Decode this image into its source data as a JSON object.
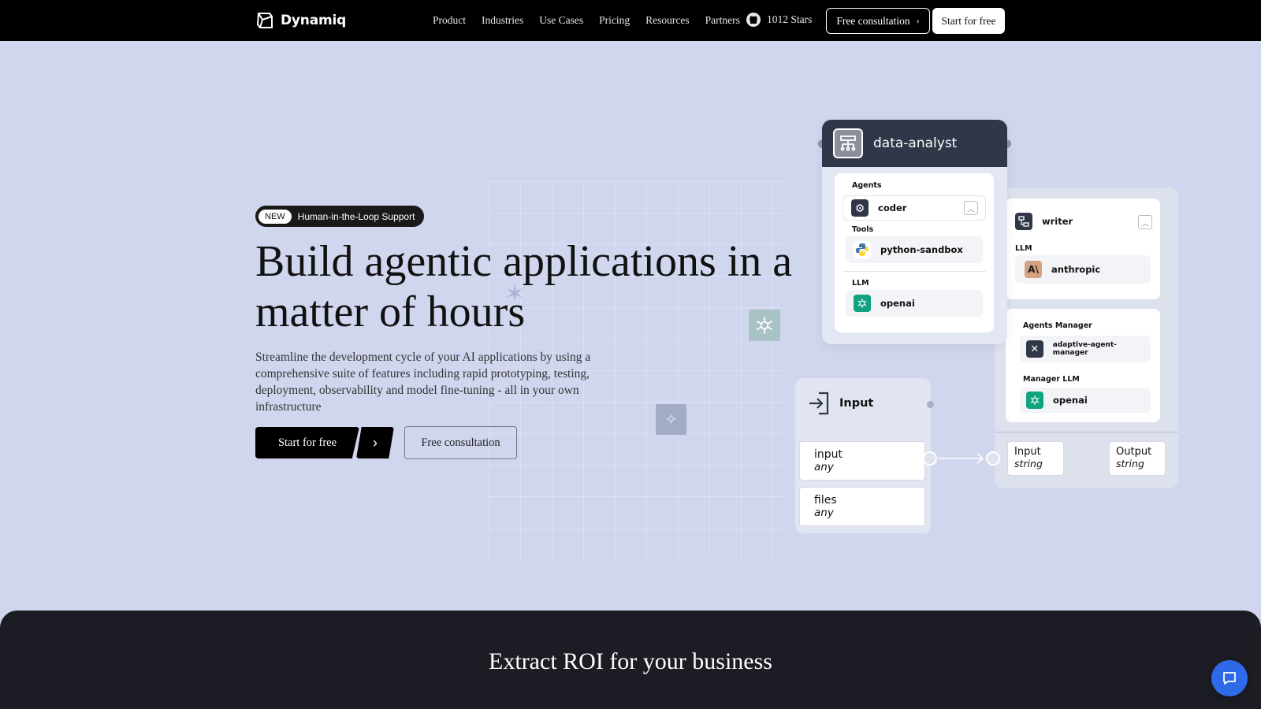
{
  "nav": {
    "logo": "Dynamiq",
    "links": [
      "Product",
      "Industries",
      "Use Cases",
      "Pricing",
      "Resources",
      "Partners"
    ],
    "stars": "1012 Stars",
    "consult_label": "Free consultation",
    "start_label": "Start for free"
  },
  "hero": {
    "badge_new": "NEW",
    "badge_text": "Human-in-the-Loop Support",
    "title": "Build agentic applications in a matter of hours",
    "subtitle": "Streamline the development cycle of your AI applications by using a comprehensive suite of features including rapid prototyping, testing, deployment, observability and model fine-tuning - all in your own infrastructure",
    "start_label": "Start for free",
    "consult_label": "Free consultation"
  },
  "data_analyst": {
    "title": "data-analyst",
    "agents_label": "Agents",
    "agent": "coder",
    "tools_label": "Tools",
    "tool": "python-sandbox",
    "llm_label": "LLM",
    "llm": "openai"
  },
  "writer": {
    "title": "writer",
    "llm_label": "LLM",
    "llm": "anthropic",
    "manager_label": "Agents Manager",
    "manager": "adaptive-agent-manager",
    "manager_llm_label": "Manager LLM",
    "manager_llm": "openai",
    "input_name": "Input",
    "input_type": "string",
    "output_name": "Output",
    "output_type": "string"
  },
  "input_node": {
    "title": "Input",
    "fields": [
      {
        "name": "input",
        "type": "any"
      },
      {
        "name": "files",
        "type": "any"
      }
    ]
  },
  "section": {
    "title": "Extract ROI for your business"
  },
  "colors": {
    "background": "#d0d6ee",
    "dark_section": "#1c1c24",
    "chat_button": "#2e6ae8",
    "openai_green": "#10a37f",
    "anthropic": "#d4a27f"
  }
}
